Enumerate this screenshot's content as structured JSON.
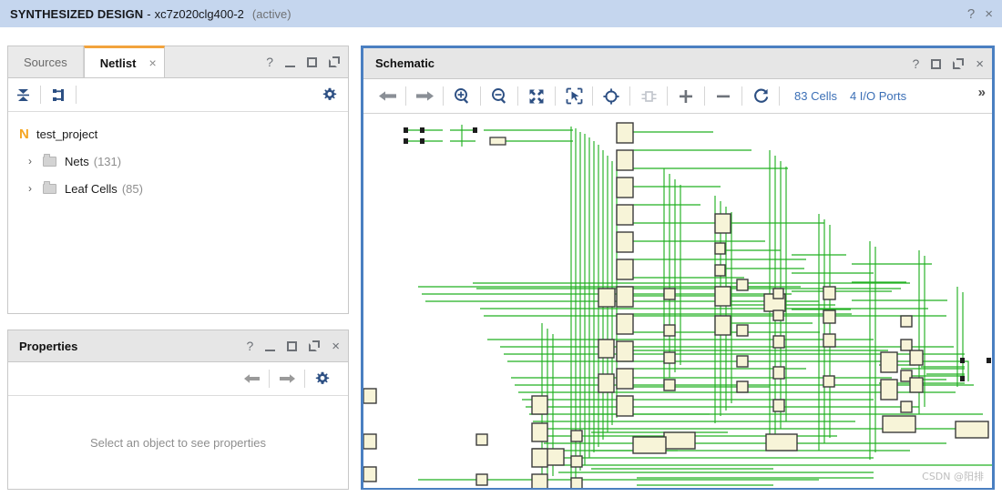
{
  "titlebar": {
    "main": "SYNTHESIZED DESIGN",
    "dash": "-",
    "device": "xc7z020clg400-2",
    "state": "(active)",
    "help_icon": "?",
    "close_icon": "×"
  },
  "netlist_panel": {
    "tabs": [
      {
        "label": "Sources",
        "active": false
      },
      {
        "label": "Netlist",
        "active": true,
        "close_icon": "×"
      }
    ],
    "controls": {
      "help": "?",
      "minimize": "minimize",
      "maximize": "maximize",
      "float": "float"
    },
    "toolbar": {
      "collapse_all": "collapse-all",
      "hierarchy": "hierarchy",
      "settings": "settings"
    },
    "tree": {
      "root": {
        "icon_letter": "N",
        "label": "test_project"
      },
      "children": [
        {
          "chevron": "›",
          "label": "Nets",
          "count": "(131)"
        },
        {
          "chevron": "›",
          "label": "Leaf Cells",
          "count": "(85)"
        }
      ]
    }
  },
  "properties_panel": {
    "title": "Properties",
    "controls": {
      "help": "?",
      "minimize": "minimize",
      "maximize": "maximize",
      "float": "float",
      "close": "×"
    },
    "toolbar": {
      "back": "back",
      "forward": "forward",
      "settings": "settings"
    },
    "empty_message": "Select an object to see properties"
  },
  "schematic_panel": {
    "title": "Schematic",
    "controls": {
      "help": "?",
      "maximize": "maximize",
      "float": "float",
      "close": "×"
    },
    "toolbar": {
      "back": "back",
      "forward": "forward",
      "zoom_in": "zoom-in",
      "zoom_out": "zoom-out",
      "zoom_fit": "zoom-fit",
      "zoom_area": "zoom-area",
      "locate": "locate",
      "cell_pins": "cell-pins",
      "expand": "+",
      "collapse": "−",
      "regenerate": "regenerate",
      "cells_label": "83 Cells",
      "io_ports_label": "4 I/O Ports",
      "overflow": "»"
    },
    "watermark": "CSDN @阳排",
    "net_color": "#22b022",
    "cell_fill": "#f7f4d8",
    "cell_stroke": "#3b3b3b"
  }
}
